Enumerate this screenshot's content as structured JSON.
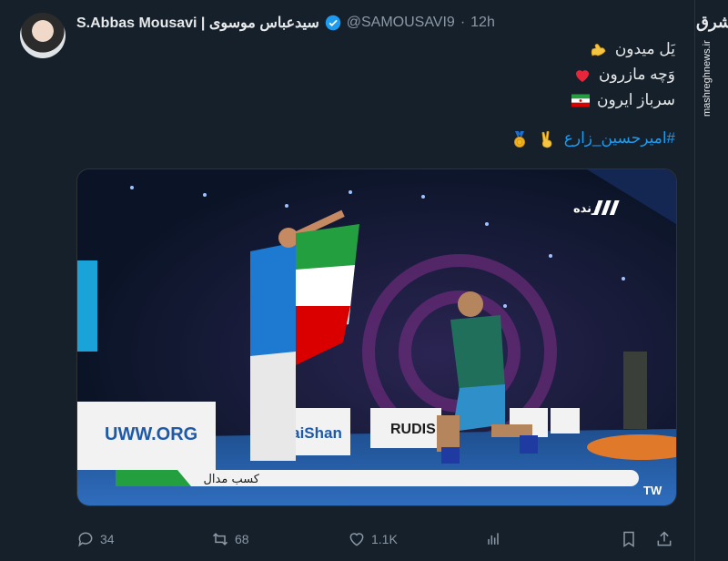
{
  "tweet": {
    "author_name": "S.Abbas Mousavi | سیدعباس موسوی",
    "handle": "@SAMOUSAVI9",
    "separator": "·",
    "time": "12h",
    "lines": [
      "یَل میدون",
      "وَچه مازرون",
      "سرباز ایرون"
    ],
    "hashtag": "#امیرحسین_زارع"
  },
  "media": {
    "channel": "زنده",
    "banner_text": "کسب مدال",
    "corner": "TW",
    "boards": [
      "UWW.ORG",
      "TaiShan",
      "RUDIS"
    ]
  },
  "actions": {
    "replies": "34",
    "retweets": "68",
    "likes": "1.1K"
  },
  "watermark": {
    "logo": "مشرق",
    "url": "mashreghnews.ir"
  },
  "colors": {
    "background": "#15202b",
    "link": "#1d9bf0",
    "muted": "#8b98a5"
  }
}
